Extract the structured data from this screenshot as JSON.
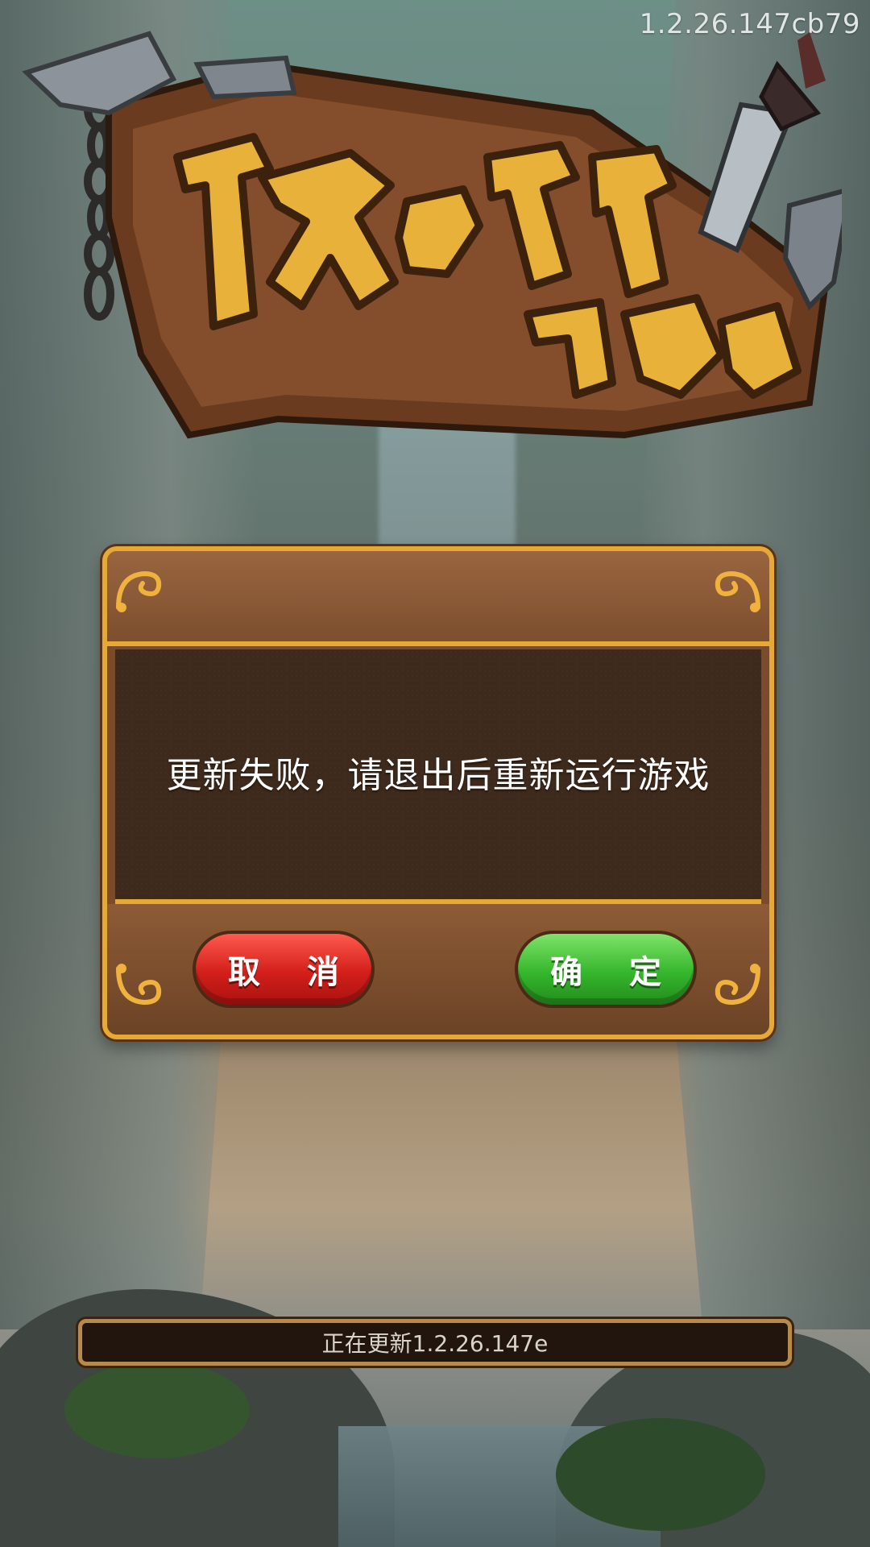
{
  "version_label": "1.2.26.147cb79",
  "logo": {
    "title_text": "坎公骑冠剑",
    "subtitle_text": "战记"
  },
  "dialog": {
    "message": "更新失败，请退出后重新运行游戏",
    "cancel_label": "取 消",
    "ok_label": "确 定"
  },
  "progress": {
    "label": "正在更新1.2.26.147e",
    "fraction": 0
  },
  "colors": {
    "frame_gold": "#e7a935",
    "cancel_red": "#d21f1a",
    "ok_green": "#35b62c"
  }
}
